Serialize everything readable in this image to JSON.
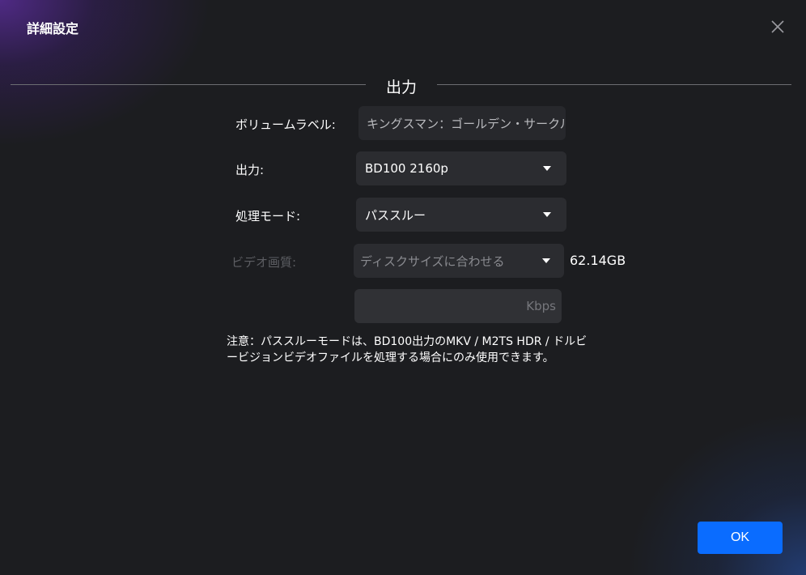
{
  "dialog": {
    "title": "詳細設定",
    "close_icon": "close-icon"
  },
  "section": {
    "title": "出力"
  },
  "form": {
    "volume_label": {
      "label": "ボリュームラベル:",
      "value": "キングスマン：ゴールデン・サークル"
    },
    "output": {
      "label": "出力:",
      "selected": "BD100 2160p"
    },
    "processing_mode": {
      "label": "処理モード:",
      "selected": "パススルー"
    },
    "video_quality": {
      "label": "ビデオ画質:",
      "selected": "ディスクサイズに合わせる",
      "size": "62.14GB"
    },
    "bitrate": {
      "unit": "Kbps",
      "value": ""
    }
  },
  "note": "注意：パススルーモードは、BD100出力のMKV / M2TS HDR / ドルビービジョンビデオファイルを処理する場合にのみ使用できます。",
  "footer": {
    "ok_label": "OK"
  },
  "colors": {
    "accent": "#0a6cff",
    "background": "#1c1d20",
    "field": "#2b2c30"
  }
}
